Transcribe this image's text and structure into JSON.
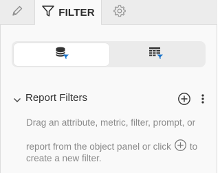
{
  "tabs": {
    "edit_icon": "pencil-icon",
    "filter_label": "FILTER",
    "filter_icon": "funnel-icon",
    "settings_icon": "gear-icon"
  },
  "view_toggle": {
    "selected": "datasets",
    "options": [
      "dataset-filter-icon",
      "grid-filter-icon"
    ],
    "accent": "#1a73c9"
  },
  "section": {
    "title": "Report Filters",
    "expanded": true
  },
  "hint": {
    "line1": "Drag an attribute, metric, filter, prompt, or",
    "line2_before": "report from the object panel or click",
    "line2_after": "to",
    "line3": "create a new filter."
  },
  "colors": {
    "tabbar_bg": "#ececec",
    "panel_bg": "#f9f9f9",
    "hint_text": "#8a8a8a"
  }
}
